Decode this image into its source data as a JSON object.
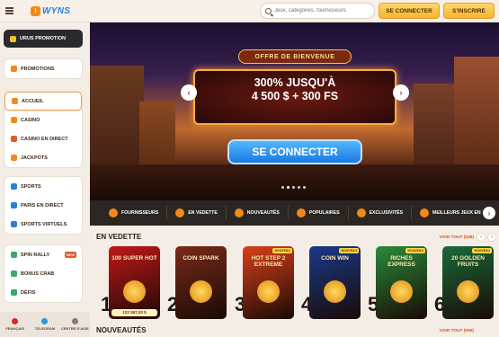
{
  "header": {
    "logo_text": "WYNS",
    "search_placeholder": "Jeux, catégories, fournisseurs",
    "login_label": "SE CONNECTER",
    "register_label": "S'INSCRIRE"
  },
  "sidebar": {
    "promo_label": "URUS PROMOTION",
    "groups": [
      [
        {
          "label": "PROMOTIONS",
          "icon": "gift-icon",
          "color": "#f08a1e"
        }
      ],
      [
        {
          "label": "ACCUEIL",
          "icon": "home-icon",
          "color": "#f08a1e",
          "active": true
        },
        {
          "label": "CASINO",
          "icon": "casino-icon",
          "color": "#f08a1e"
        },
        {
          "label": "CASINO EN DIRECT",
          "icon": "live-casino-icon",
          "color": "#e25a2c"
        },
        {
          "label": "JACKPOTS",
          "icon": "jackpot-icon",
          "color": "#f08a1e"
        }
      ],
      [
        {
          "label": "SPORTS",
          "icon": "sports-icon",
          "color": "#2a7fd8"
        },
        {
          "label": "PARIS EN DIRECT",
          "icon": "live-bets-icon",
          "color": "#2a7fd8"
        },
        {
          "label": "SPORTS VIRTUELS",
          "icon": "virtual-sports-icon",
          "color": "#2a7fd8"
        }
      ],
      [
        {
          "label": "SPIN RALLY",
          "icon": "spin-rally-icon",
          "color": "#3aa86a",
          "tag": "NEW"
        },
        {
          "label": "BONUS CRAB",
          "icon": "crab-icon",
          "color": "#3aa86a"
        },
        {
          "label": "DÉFIS",
          "icon": "challenge-icon",
          "color": "#3aa86a"
        }
      ]
    ],
    "footer": [
      {
        "label": "FRANÇAIS",
        "icon": "flag-icon"
      },
      {
        "label": "TELEGRAM",
        "icon": "telegram-icon"
      },
      {
        "label": "CENTRE D'AIDE",
        "icon": "help-icon"
      }
    ]
  },
  "hero": {
    "sign_top": "OFFRE DE BIENVENUE",
    "line1": "300% JUSQU'À",
    "line2": "4 500 $ + 300 FS",
    "cta": "SE CONNECTER",
    "slide_count": 5,
    "active_slide": 1
  },
  "categories": [
    {
      "label": "FOURNISSEURS",
      "icon": "providers-icon"
    },
    {
      "label": "EN VEDETTE",
      "icon": "featured-icon"
    },
    {
      "label": "NOUVEAUTÉS",
      "icon": "new-icon"
    },
    {
      "label": "POPULAIRES",
      "icon": "popular-icon"
    },
    {
      "label": "EXCLUSIVITÉS",
      "icon": "exclusive-icon"
    },
    {
      "label": "MEILLEURS JEUX EN",
      "icon": "best-games-icon"
    }
  ],
  "featured": {
    "title": "EN VEDETTE",
    "view_all": "VOIR TOUT (548)",
    "games": [
      {
        "rank": "1",
        "title": "100 SUPER HOT",
        "badge": "",
        "jackpot": "122 367,20 $",
        "bg": "#c01818"
      },
      {
        "rank": "2",
        "title": "COIN SPARK",
        "badge": "",
        "jackpot": "",
        "bg": "#7a2a1a"
      },
      {
        "rank": "3",
        "title": "HOT STEP 2 EXTREME",
        "badge": "NOUVEAU",
        "jackpot": "",
        "bg": "#d8401a"
      },
      {
        "rank": "4",
        "title": "COIN WIN",
        "badge": "NOUVEAU",
        "jackpot": "",
        "bg": "#1a3a8a"
      },
      {
        "rank": "5",
        "title": "RICHES EXPRESS",
        "badge": "NOUVEAU",
        "jackpot": "",
        "bg": "#2a8a3a"
      },
      {
        "rank": "6",
        "title": "20 GOLDEN FRUITS",
        "badge": "NOUVEAU",
        "jackpot": "",
        "bg": "#1a6a3a"
      }
    ]
  },
  "new_section": {
    "title": "NOUVEAUTÉS",
    "view_all": "VOIR TOUT (595)"
  }
}
